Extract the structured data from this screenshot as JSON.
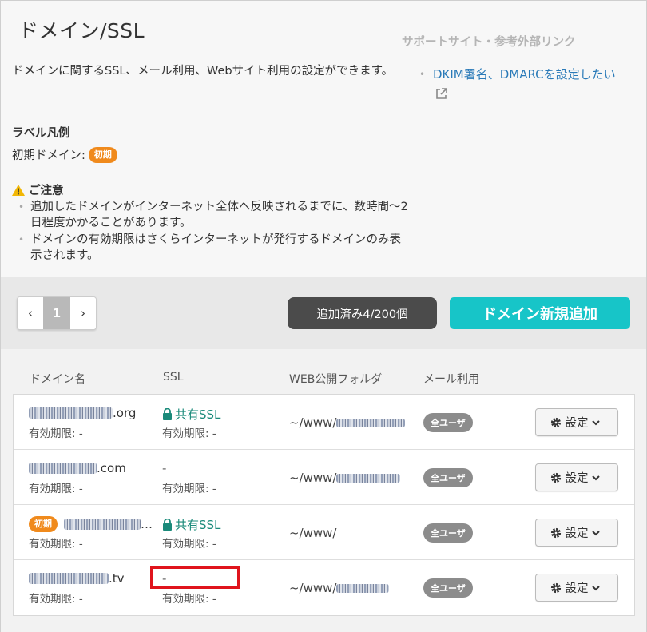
{
  "page": {
    "title": "ドメイン/SSL",
    "description": "ドメインに関するSSL、メール利用、Webサイト利用の設定ができます。",
    "legend_title": "ラベル凡例",
    "legend_label": "初期ドメイン:",
    "legend_badge": "初期",
    "notice_title": "ご注意",
    "notices": [
      "追加したドメインがインターネット全体へ反映されるまでに、数時間〜2日程度かかることがあります。",
      "ドメインの有効期限はさくらインターネットが発行するドメインのみ表示されます。"
    ]
  },
  "support": {
    "title": "サポートサイト・参考外部リンク",
    "link": "DKIM署名、DMARCを設定したい"
  },
  "toolbar": {
    "prev": "‹",
    "page": "1",
    "next": "›",
    "count": "追加済み4/200個",
    "add_label": "ドメイン新規追加"
  },
  "table": {
    "headers": [
      "ドメイン名",
      "SSL",
      "WEB公開フォルダ",
      "メール利用"
    ],
    "rows": [
      {
        "domain_suffix": ".org",
        "initial": false,
        "expire": "有効期限: -",
        "ssl": "共有SSL",
        "ssl_expire": "有効期限: -",
        "web": "~/www/",
        "mail": "全ユーザ",
        "settings": "設定"
      },
      {
        "domain_suffix": ".com",
        "initial": false,
        "expire": "有効期限: -",
        "ssl": "-",
        "ssl_expire": "有効期限: -",
        "web": "~/www/",
        "mail": "全ユーザ",
        "settings": "設定"
      },
      {
        "domain_suffix": "…",
        "initial": true,
        "badge": "初期",
        "expire": "有効期限: -",
        "ssl": "共有SSL",
        "ssl_expire": "有効期限: -",
        "web": "~/www/",
        "mail": "全ユーザ",
        "settings": "設定"
      },
      {
        "domain_suffix": ".tv",
        "initial": false,
        "expire": "有効期限: -",
        "ssl": "-",
        "ssl_expire": "有効期限: -",
        "web": "~/www/",
        "mail": "全ユーザ",
        "settings": "設定"
      }
    ]
  },
  "colors": {
    "accent": "#17c5c8",
    "badge_initial": "#f08a1c",
    "ssl_text": "#1a8a7a",
    "link": "#2a7ab8",
    "highlight": "#e0141c"
  }
}
